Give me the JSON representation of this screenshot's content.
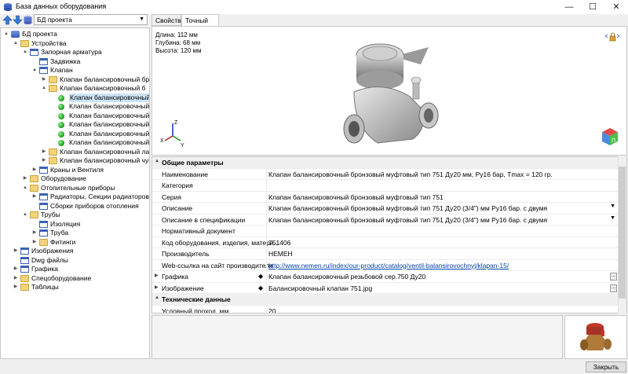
{
  "window": {
    "title": "База данных оборудования",
    "controls": [
      "—",
      "☐",
      "✕"
    ]
  },
  "toolbar": {
    "db_selector": "БД проекта"
  },
  "tabs": [
    {
      "label": "Свойства"
    },
    {
      "label": "Точный вид"
    }
  ],
  "viewer": {
    "dims": [
      "Длина: 112 мм",
      "Глубина: 68 мм",
      "Высота: 120 мм"
    ],
    "axes": {
      "z": "Z",
      "x": "X",
      "y": "Y"
    },
    "cube_label": "П"
  },
  "tree": [
    {
      "label": "БД проекта",
      "level": 0,
      "toggle": "▲",
      "icon": "db"
    },
    {
      "label": "Устройства",
      "level": 1,
      "toggle": "▲",
      "icon": "folder"
    },
    {
      "label": "Запорная арматура",
      "level": 2,
      "toggle": "▲",
      "icon": "table"
    },
    {
      "label": "Задвижка",
      "level": 3,
      "toggle": "",
      "icon": "table"
    },
    {
      "label": "Клапан",
      "level": 3,
      "toggle": "▲",
      "icon": "table"
    },
    {
      "label": "Клапан балансировочный брон",
      "level": 4,
      "toggle": "▶",
      "icon": "folder"
    },
    {
      "label": "Клапан балансировочный б",
      "level": 4,
      "toggle": "▲",
      "icon": "folder"
    },
    {
      "label": "Клапан балансировочный б",
      "level": 5,
      "toggle": "",
      "icon": "dot",
      "selected": true
    },
    {
      "label": "Клапан балансировочный б",
      "level": 5,
      "toggle": "",
      "icon": "dot"
    },
    {
      "label": "Клапан балансировочный б",
      "level": 5,
      "toggle": "",
      "icon": "dot"
    },
    {
      "label": "Клапан балансировочный б",
      "level": 5,
      "toggle": "",
      "icon": "dot"
    },
    {
      "label": "Клапан балансировочный б",
      "level": 5,
      "toggle": "",
      "icon": "dot"
    },
    {
      "label": "Клапан балансировочный б",
      "level": 5,
      "toggle": "",
      "icon": "dot"
    },
    {
      "label": "Клапан балансировочный латун",
      "level": 4,
      "toggle": "▶",
      "icon": "folder"
    },
    {
      "label": "Клапан балансировочный чугун",
      "level": 4,
      "toggle": "▶",
      "icon": "folder"
    },
    {
      "label": "Краны и Вентиля",
      "level": 3,
      "toggle": "▶",
      "icon": "table"
    },
    {
      "label": "Оборудование",
      "level": 2,
      "toggle": "▶",
      "icon": "folder"
    },
    {
      "label": "Отопительные приборы",
      "level": 2,
      "toggle": "▲",
      "icon": "folder"
    },
    {
      "label": "Радиаторы, Секции радиаторов и К",
      "level": 3,
      "toggle": "▶",
      "icon": "table"
    },
    {
      "label": "Сборки приборов отопления",
      "level": 3,
      "toggle": "",
      "icon": "table"
    },
    {
      "label": "Трубы",
      "level": 2,
      "toggle": "▲",
      "icon": "folder"
    },
    {
      "label": "Изоляция",
      "level": 3,
      "toggle": "",
      "icon": "table"
    },
    {
      "label": "Труба",
      "level": 3,
      "toggle": "▶",
      "icon": "table"
    },
    {
      "label": "Фитинги",
      "level": 3,
      "toggle": "▶",
      "icon": "folder"
    },
    {
      "label": "Изображения",
      "level": 1,
      "toggle": "▶",
      "icon": "table"
    },
    {
      "label": "Dwg файлы",
      "level": 1,
      "toggle": "",
      "icon": "table"
    },
    {
      "label": "Графика",
      "level": 1,
      "toggle": "▶",
      "icon": "table"
    },
    {
      "label": "Спецоборудование",
      "level": 1,
      "toggle": "▶",
      "icon": "folder"
    },
    {
      "label": "Таблицы",
      "level": 1,
      "toggle": "▶",
      "icon": "folder"
    }
  ],
  "properties": [
    {
      "type": "cat",
      "name": "Общие параметры",
      "toggle": "▲"
    },
    {
      "type": "row",
      "name": "Наименование",
      "value": "Клапан балансировочный бронзовый муфтовый тип 751 Ду20 мм, Ру16 бар, Tmax = 120 гр."
    },
    {
      "type": "row",
      "name": "Категория",
      "value": ""
    },
    {
      "type": "row",
      "name": "Серия",
      "value": "Клапан балансировочный бронзовый муфтовый тип 751"
    },
    {
      "type": "row",
      "name": "Описание",
      "value": "Клапан балансировочный бронзовый муфтовый тип 751 Ду20 (3/4\") мм Ру16 бар. с двумя",
      "dropdown": true
    },
    {
      "type": "row",
      "name": "Описание в спецификации",
      "value": "Клапан балансировочный бронзовый муфтовый тип 751 Ду20 (3/4\") мм Ру16 бар. с двумя",
      "dropdown": true
    },
    {
      "type": "row",
      "name": "Нормативный документ",
      "value": ""
    },
    {
      "type": "row",
      "name": "Код оборудования, изделия, матери...",
      "value": "751406"
    },
    {
      "type": "row",
      "name": "Производитель",
      "value": "HEMEH"
    },
    {
      "type": "row",
      "name": "Web-ссылка на сайт производителя",
      "value": "http://www.nemen.ru/index/our-product/catalog/ventil-balansirovochnyj/klapan-15/",
      "link": true
    },
    {
      "type": "row",
      "name": "Графика",
      "value": "Клапан балансировочный резьбовой сер.750 Ду20",
      "toggle": "▶",
      "diamond": true,
      "ellipsis": true
    },
    {
      "type": "row",
      "name": "Изображение",
      "value": "Балансировочный клапан 751.jpg",
      "toggle": "▶",
      "diamond": true,
      "ellipsis": true
    },
    {
      "type": "cat",
      "name": "Технические данные",
      "toggle": "▲"
    },
    {
      "type": "row",
      "name": "Условный проход, мм",
      "value": "20"
    }
  ],
  "footer": {
    "close_label": "Закрыть"
  }
}
